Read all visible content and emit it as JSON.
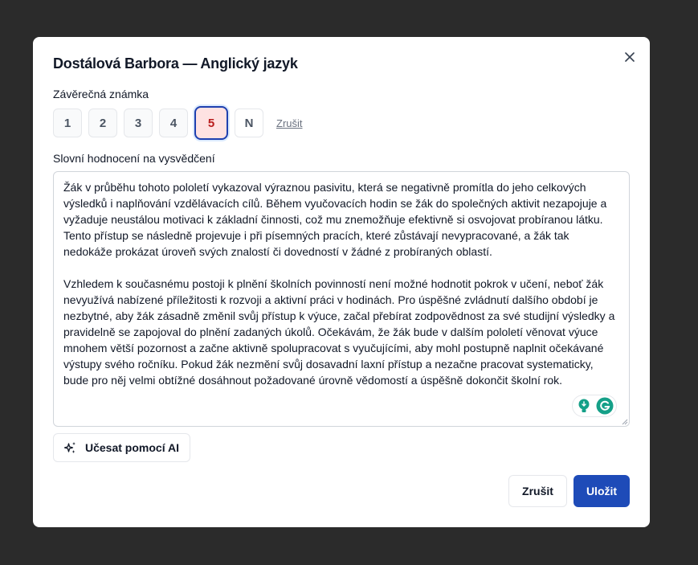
{
  "dialog": {
    "title": "Dostálová Barbora — Anglický jazyk",
    "close_icon": "close-icon"
  },
  "grade": {
    "label": "Závěrečná známka",
    "options": [
      "1",
      "2",
      "3",
      "4",
      "5",
      "N"
    ],
    "selected": "5",
    "clear_label": "Zrušit",
    "colors": {
      "selected_border": "#1e40af",
      "selected_bg": "#fee2e2",
      "selected_text": "#b91c1c"
    }
  },
  "evaluation": {
    "label": "Slovní hodnocení na vysvědčení",
    "paragraphs": [
      "Žák v průběhu tohoto pololetí vykazoval výraznou pasivitu, která se negativně promítla do jeho celkových výsledků i naplňování vzdělávacích cílů. Během vyučovacích hodin se žák do společných aktivit nezapojuje a vyžaduje neustálou motivaci k základní činnosti, což mu znemožňuje efektivně si osvojovat probíranou látku. Tento přístup se následně projevuje i při písemných pracích, které zůstávají nevypracované, a žák tak nedokáže prokázat úroveň svých znalostí či dovedností v žádné z probíraných oblastí.",
      "Vzhledem k současnému postoji k plnění školních povinností není možné hodnotit pokrok v učení, neboť žák nevyužívá nabízené příležitosti k rozvoji a aktivní práci v hodinách. Pro úspěšné zvládnutí dalšího období je nezbytné, aby žák zásadně změnil svůj přístup k výuce, začal přebírat zodpovědnost za své studijní výsledky a pravidelně se zapojoval do plnění zadaných úkolů. Očekávám, že žák bude v dalším pololetí věnovat výuce mnohem větší pozornost a začne aktivně spolupracovat s vyučujícími, aby mohl postupně naplnit očekávané výstupy svého ročníku. Pokud žák nezmění svůj dosavadní laxní přístup a nezačne pracovat systematicky, bude pro něj velmi obtížné dosáhnout požadované úrovně vědomostí a úspěšně dokončit školní rok."
    ]
  },
  "ai_button": {
    "label": "Učesat pomocí AI",
    "icon": "sparkles-icon"
  },
  "footer": {
    "cancel_label": "Zrušit",
    "save_label": "Uložit",
    "save_color": "#1e4bb8"
  }
}
